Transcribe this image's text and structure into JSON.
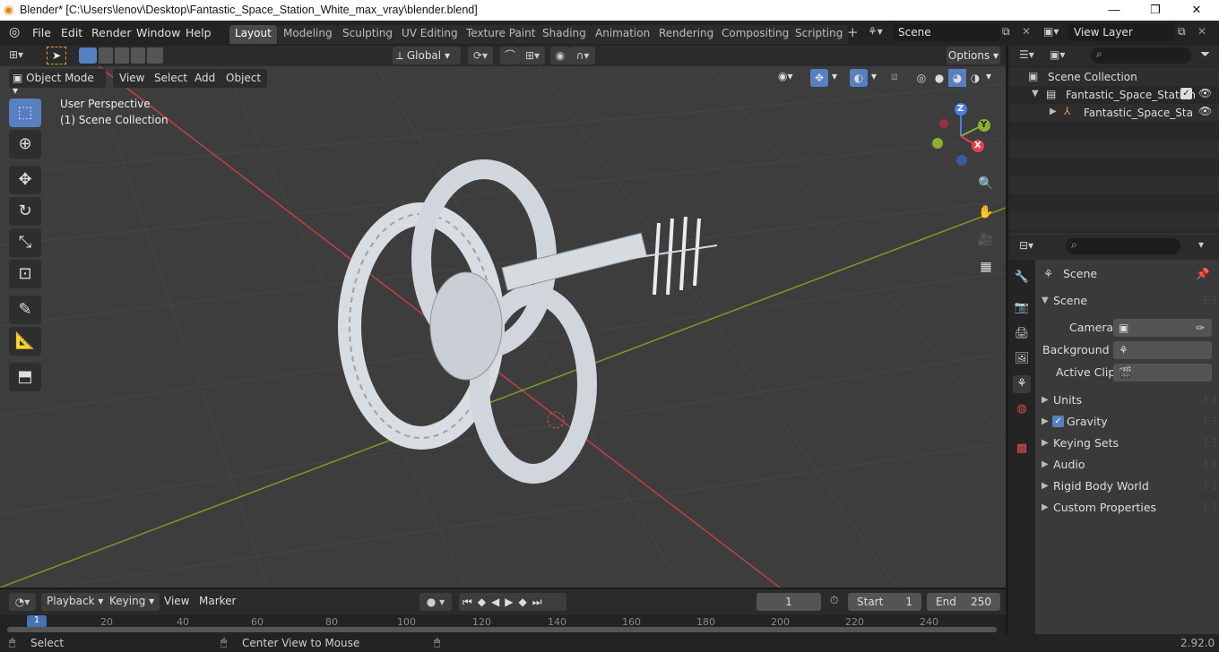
{
  "window": {
    "title": "Blender* [C:\\Users\\lenov\\Desktop\\Fantastic_Space_Station_White_max_vray\\blender.blend]",
    "minimize": "—",
    "maximize": "❐",
    "close": "✕"
  },
  "menu": [
    "File",
    "Edit",
    "Render",
    "Window",
    "Help"
  ],
  "workspaces": [
    "Layout",
    "Modeling",
    "Sculpting",
    "UV Editing",
    "Texture Paint",
    "Shading",
    "Animation",
    "Rendering",
    "Compositing",
    "Scripting"
  ],
  "scene_field": "Scene",
  "view_layer_field": "View Layer",
  "toolbar": {
    "transform_orientation": "Global",
    "options": "Options"
  },
  "viewport_header": {
    "mode": "Object Mode",
    "menus": [
      "View",
      "Select",
      "Add",
      "Object"
    ]
  },
  "viewport": {
    "perspective": "User Perspective",
    "collection": "(1) Scene Collection",
    "gizmo": {
      "z": "Z",
      "y": "Y",
      "x": "X"
    }
  },
  "outliner": {
    "root": "Scene Collection",
    "collection": "Fantastic_Space_Station",
    "object": "Fantastic_Space_Sta"
  },
  "properties": {
    "context": "Scene",
    "panel": "Scene",
    "camera_label": "Camera",
    "background_label": "Background ...",
    "active_clip_label": "Active Clip",
    "sections": [
      "Units",
      "Gravity",
      "Keying Sets",
      "Audio",
      "Rigid Body World",
      "Custom Properties"
    ]
  },
  "timeline": {
    "menus": [
      "Playback",
      "Keying",
      "View",
      "Marker"
    ],
    "current_frame": "1",
    "start_label": "Start",
    "start": "1",
    "end_label": "End",
    "end": "250",
    "ruler": [
      "1",
      "20",
      "40",
      "60",
      "80",
      "100",
      "120",
      "140",
      "160",
      "180",
      "200",
      "220",
      "240"
    ]
  },
  "statusbar": {
    "select": "Select",
    "center": "Center View to Mouse",
    "version": "2.92.0"
  },
  "colors": {
    "accent": "#5680c2",
    "x_axis": "#c44040",
    "y_axis": "#7a9c28"
  }
}
